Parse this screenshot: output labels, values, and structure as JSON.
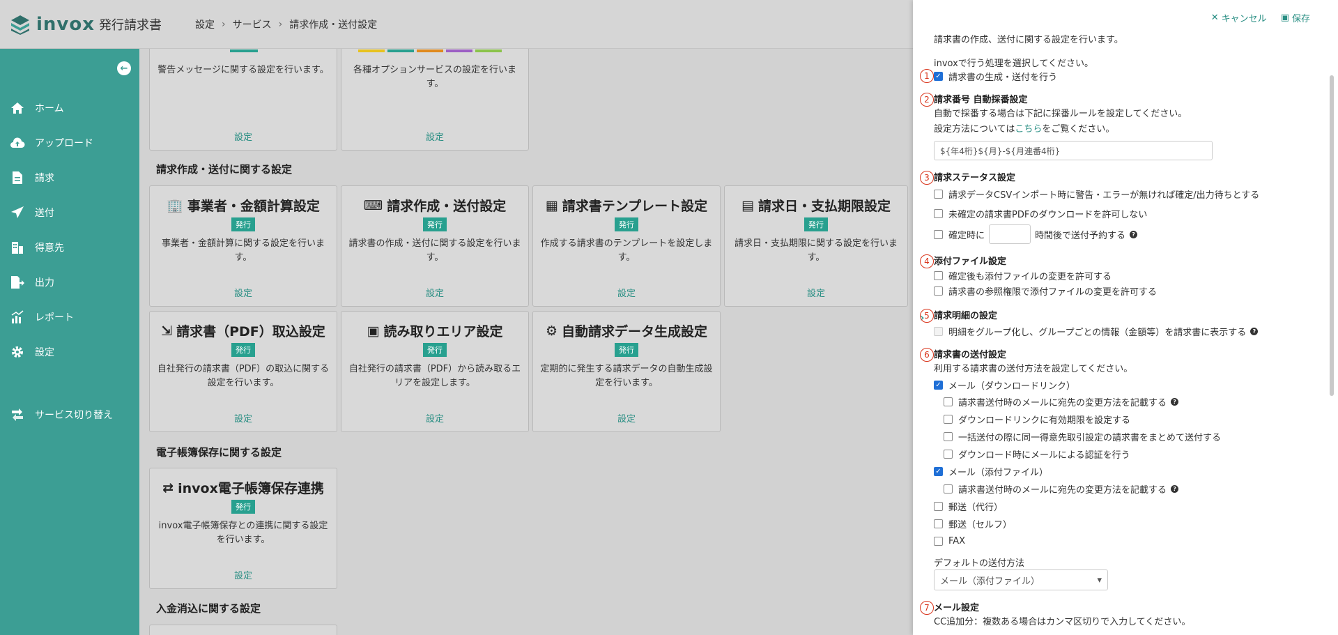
{
  "header": {
    "logo_text": "invox",
    "logo_sub": "発行請求書",
    "breadcrumb": [
      "設定",
      "サービス",
      "請求作成・送付設定"
    ]
  },
  "sidebar": {
    "items": [
      {
        "label": "ホーム",
        "icon": "home-icon"
      },
      {
        "label": "アップロード",
        "icon": "cloud-upload-icon"
      },
      {
        "label": "請求",
        "icon": "document-icon"
      },
      {
        "label": "送付",
        "icon": "send-icon"
      },
      {
        "label": "得意先",
        "icon": "building-icon"
      },
      {
        "label": "出力",
        "icon": "export-icon"
      },
      {
        "label": "レポート",
        "icon": "chart-icon"
      },
      {
        "label": "設定",
        "icon": "gear-icon"
      }
    ],
    "switch_label": "サービス切り替え"
  },
  "main": {
    "top_cards": [
      {
        "desc": "警告メッセージに関する設定を行います。",
        "link": "設定"
      },
      {
        "desc": "各種オプションサービスの設定を行います。",
        "link": "設定"
      }
    ],
    "section1": "請求作成・送付に関する設定",
    "cards1": [
      {
        "title": "事業者・金額計算設定",
        "badge": "発行",
        "desc": "事業者・金額計算に関する設定を行います。",
        "link": "設定"
      },
      {
        "title": "請求作成・送付設定",
        "badge": "発行",
        "desc": "請求書の作成・送付に関する設定を行います。",
        "link": "設定"
      },
      {
        "title": "請求書テンプレート設定",
        "badge": "発行",
        "desc": "作成する請求書のテンプレートを設定します。",
        "link": "設定"
      },
      {
        "title": "請求日・支払期限設定",
        "badge": "発行",
        "desc": "請求日・支払期限に関する設定を行います。",
        "link": "設定"
      }
    ],
    "cards2": [
      {
        "title": "請求書（PDF）取込設定",
        "badge": "発行",
        "desc": "自社発行の請求書（PDF）の取込に関する設定を行います。",
        "link": "設定"
      },
      {
        "title": "読み取りエリア設定",
        "badge": "発行",
        "desc": "自社発行の請求書（PDF）から読み取るエリアを設定します。",
        "link": "設定"
      },
      {
        "title": "自動請求データ生成設定",
        "badge": "発行",
        "desc": "定期的に発生する請求データの自動生成設定を行います。",
        "link": "設定"
      }
    ],
    "section2": "電子帳簿保存に関する設定",
    "cards3": [
      {
        "title": "invox電子帳簿保存連携",
        "badge": "発行",
        "desc": "invox電子帳簿保存との連携に関する設定を行います。",
        "link": "設定"
      }
    ],
    "section3": "入金消込に関する設定"
  },
  "panel": {
    "cancel": "キャンセル",
    "save": "保存",
    "intro": "請求書の作成、送付に関する設定を行います。",
    "process_prompt": "invoxで行う処理を選択してください。",
    "n1_label": "請求書の生成・送付を行う",
    "n2_title": "請求番号 自動採番設定",
    "n2_desc1": "自動で採番する場合は下記に採番ルールを設定してください。",
    "n2_desc2_pre": "設定方法については",
    "n2_desc2_link": "こちら",
    "n2_desc2_post": "をご覧ください。",
    "n2_value": "${年4桁}${月}-${月連番4桁}",
    "n3_title": "請求ステータス設定",
    "n3_opt1": "請求データCSVインポート時に警告・エラーが無ければ確定/出力待ちとする",
    "n3_opt2": "未確定の請求書PDFのダウンロードを許可しない",
    "n3_opt3_pre": "確定時に",
    "n3_opt3_post": "時間後で送付予約する",
    "n4_title": "添付ファイル設定",
    "n4_opt1": "確定後も添付ファイルの変更を許可する",
    "n4_opt2": "請求書の参照権限で添付ファイルの変更を許可する",
    "n5_title": "請求明細の設定",
    "n5_opt1": "明細をグループ化し、グループごとの情報（金額等）を請求書に表示する",
    "n6_title": "請求書の送付設定",
    "n6_desc": "利用する請求書の送付方法を設定してください。",
    "n6_mail_dl": "メール（ダウンロードリンク）",
    "n6_mail_dl_sub1": "請求書送付時のメールに宛先の変更方法を記載する",
    "n6_mail_dl_sub2": "ダウンロードリンクに有効期限を設定する",
    "n6_mail_dl_sub3": "一括送付の際に同一得意先取引設定の請求書をまとめて送付する",
    "n6_mail_dl_sub4": "ダウンロード時にメールによる認証を行う",
    "n6_mail_att": "メール（添付ファイル）",
    "n6_mail_att_sub1": "請求書送付時のメールに宛先の変更方法を記載する",
    "n6_post_agent": "郵送（代行）",
    "n6_post_self": "郵送（セルフ）",
    "n6_fax": "FAX",
    "n6_default_label": "デフォルトの送付方法",
    "n6_default_value": "メール（添付ファイル）",
    "n7_title": "メール設定",
    "n7_desc": "CC追加分：複数ある場合はカンマ区切りで入力してください。"
  }
}
